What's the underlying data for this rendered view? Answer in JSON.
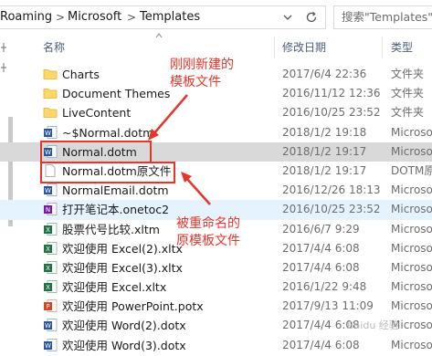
{
  "address_bar": {
    "crumbs": [
      "Roaming",
      "Microsoft",
      "Templates"
    ],
    "search_placeholder": "搜索\"Templates\""
  },
  "columns": {
    "name": "名称",
    "date": "修改日期",
    "type": "类型"
  },
  "files": [
    {
      "name": "Charts",
      "date": "2017/6/4 22:36",
      "type": "文件夹",
      "icon": "folder-icon"
    },
    {
      "name": "Document Themes",
      "date": "2016/11/12 12:36",
      "type": "文件夹",
      "icon": "folder-icon"
    },
    {
      "name": "LiveContent",
      "date": "2016/10/25 23:52",
      "type": "文件夹",
      "icon": "folder-icon"
    },
    {
      "name": "~$Normal.dotm",
      "date": "2018/1/2 19:18",
      "type": "Microso",
      "icon": "word-template-icon"
    },
    {
      "name": "Normal.dotm",
      "date": "2018/1/2 19:17",
      "type": "Microso",
      "icon": "word-template-icon"
    },
    {
      "name": "Normal.dotm原文件",
      "date": "2018/1/2 19:17",
      "type": "DOTM原",
      "icon": "blank-file-icon"
    },
    {
      "name": "NormalEmail.dotm",
      "date": "2016/12/26 18:13",
      "type": "Microso",
      "icon": "word-template-icon"
    },
    {
      "name": "打开笔记本.onetoc2",
      "date": "2016/10/25 23:52",
      "type": "Microso",
      "icon": "onenote-icon"
    },
    {
      "name": "股票代号比较.xltm",
      "date": "2016/6/7 9:29",
      "type": "Microso",
      "icon": "excel-template-icon"
    },
    {
      "name": "欢迎使用 Excel(2).xltx",
      "date": "2017/4/4 6:08",
      "type": "Microso",
      "icon": "excel-template-icon"
    },
    {
      "name": "欢迎使用 Excel(3).xltx",
      "date": "2017/4/4 6:08",
      "type": "Microso",
      "icon": "excel-template-icon"
    },
    {
      "name": "欢迎使用 Excel.xltx",
      "date": "2016/1/22 9:48",
      "type": "Microso",
      "icon": "excel-template-icon"
    },
    {
      "name": "欢迎使用 PowerPoint.potx",
      "date": "2017/9/13 11:09",
      "type": "Microso",
      "icon": "powerpoint-template-icon"
    },
    {
      "name": "欢迎使用 Word(2).dotx",
      "date": "2017/4/4 6:08",
      "type": "Microso",
      "icon": "word-template-icon"
    },
    {
      "name": "欢迎使用 Word(3).dotx",
      "date": "2017/4/4 6:08",
      "type": "Microso",
      "icon": "word-template-icon"
    }
  ],
  "annotations": {
    "note_new_line1": "刚刚新建的",
    "note_new_line2": "模板文件",
    "note_renamed_line1": "被重命名的",
    "note_renamed_line2": "原模板文件",
    "color": "#e8352b"
  },
  "colors": {
    "selected_row": "#d9d9d9",
    "hover_row": "#e5f3ff",
    "header_text": "#4c607a",
    "folder": "#ffd767",
    "word": "#2b579a",
    "excel": "#217346",
    "powerpoint": "#d24726",
    "onenote": "#7719aa"
  },
  "watermark": "Baidu 经验"
}
